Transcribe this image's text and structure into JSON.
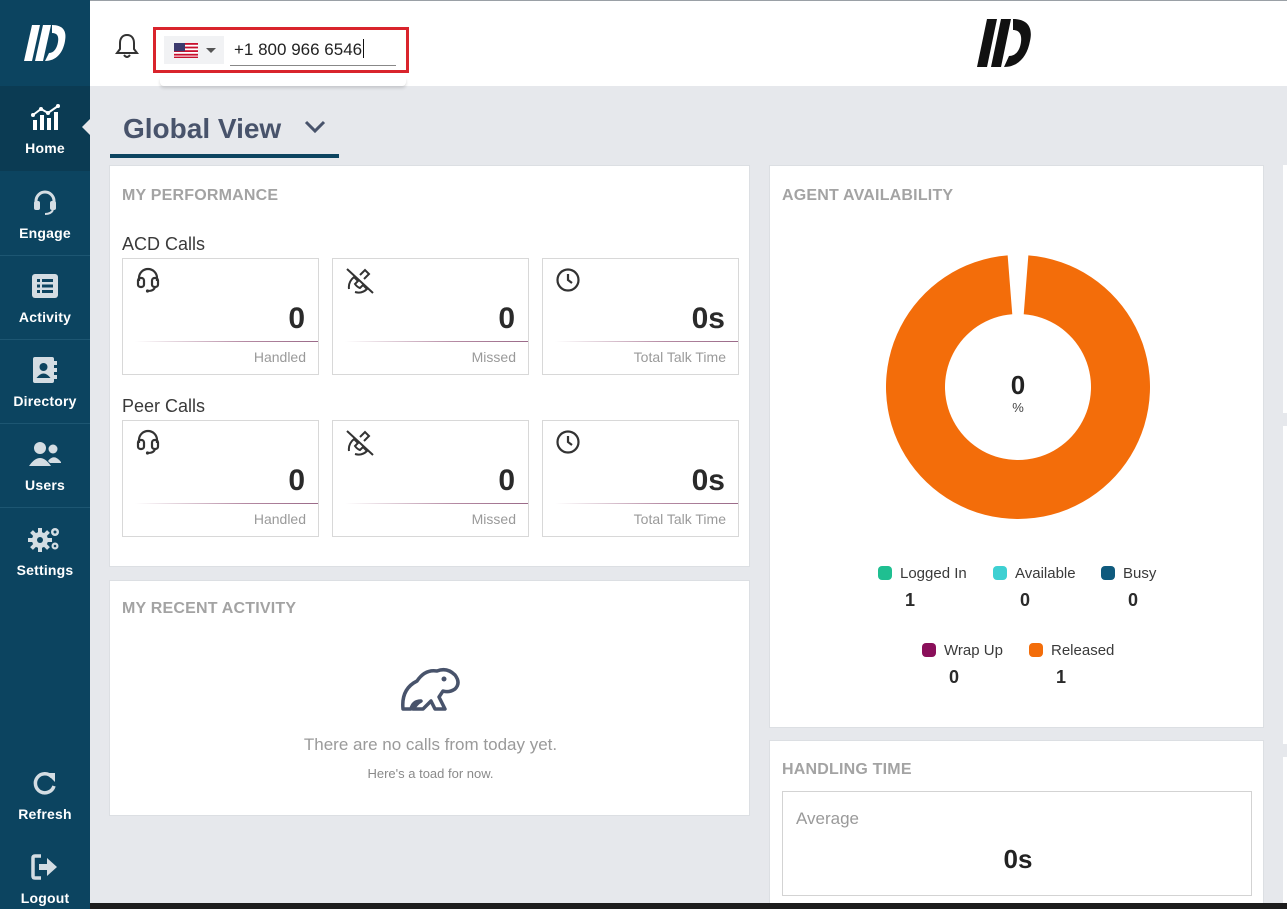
{
  "sidebar": {
    "items": [
      {
        "label": "Home",
        "icon": "chart-icon"
      },
      {
        "label": "Engage",
        "icon": "headset-icon"
      },
      {
        "label": "Activity",
        "icon": "list-icon"
      },
      {
        "label": "Directory",
        "icon": "contact-book-icon"
      },
      {
        "label": "Users",
        "icon": "users-icon"
      },
      {
        "label": "Settings",
        "icon": "gears-icon"
      },
      {
        "label": "Refresh",
        "icon": "refresh-icon"
      },
      {
        "label": "Logout",
        "icon": "logout-icon"
      }
    ]
  },
  "header": {
    "phone_number": "+1 800 966 6546",
    "country": "US"
  },
  "view": {
    "title": "Global View"
  },
  "performance": {
    "title": "MY PERFORMANCE",
    "acd": {
      "label": "ACD Calls",
      "handled": "0",
      "handled_label": "Handled",
      "missed": "0",
      "missed_label": "Missed",
      "talk": "0s",
      "talk_label": "Total Talk Time"
    },
    "peer": {
      "label": "Peer Calls",
      "handled": "0",
      "handled_label": "Handled",
      "missed": "0",
      "missed_label": "Missed",
      "talk": "0s",
      "talk_label": "Total Talk Time"
    }
  },
  "recent": {
    "title": "MY RECENT ACTIVITY",
    "empty_message": "There are no calls from today yet.",
    "empty_sub": "Here's a toad for now."
  },
  "availability": {
    "title": "AGENT AVAILABILITY",
    "center_value": "0",
    "center_unit": "%",
    "donut_color": "#f36d0a",
    "legend": [
      {
        "label": "Logged In",
        "value": "1",
        "color": "#1fbf91"
      },
      {
        "label": "Available",
        "value": "0",
        "color": "#3ed0d2"
      },
      {
        "label": "Busy",
        "value": "0",
        "color": "#0f5a7d"
      },
      {
        "label": "Wrap Up",
        "value": "0",
        "color": "#8a0f5a"
      },
      {
        "label": "Released",
        "value": "1",
        "color": "#f36d0a"
      }
    ]
  },
  "handling": {
    "title": "HANDLING TIME",
    "average_label": "Average",
    "average_value": "0s"
  }
}
